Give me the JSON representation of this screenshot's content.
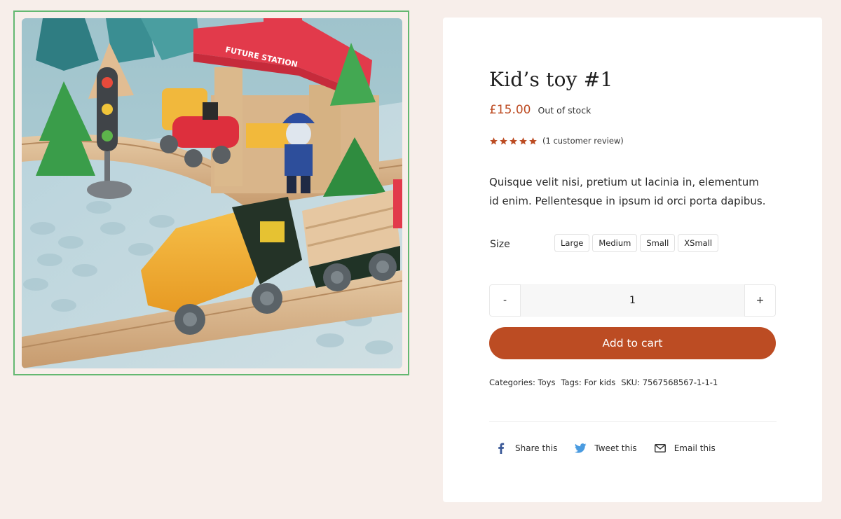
{
  "product": {
    "title": "Kid’s toy #1",
    "price": "£15.00",
    "stock_status": "Out of stock",
    "rating": {
      "stars": 5,
      "review_text": "(1 customer review)"
    },
    "description": "Quisque velit nisi, pretium ut lacinia in, elementum id enim. Pellentesque in ipsum id orci porta dapibus.",
    "size": {
      "label": "Size",
      "options": [
        "Large",
        "Medium",
        "Small",
        "XSmall"
      ]
    },
    "quantity": {
      "value": "1",
      "minus_label": "-",
      "plus_label": "+"
    },
    "add_to_cart_label": "Add to cart",
    "meta": {
      "categories_label": "Categories:",
      "categories": "Toys",
      "tags_label": "Tags:",
      "tags": "For kids",
      "sku_label": "SKU:",
      "sku": "7567568567-1-1-1"
    },
    "share": [
      {
        "label": "Share this",
        "icon": "facebook-icon",
        "color": "#3b5998"
      },
      {
        "label": "Tweet this",
        "icon": "twitter-icon",
        "color": "#4a9be0"
      },
      {
        "label": "Email this",
        "icon": "email-icon",
        "color": "#333333"
      }
    ],
    "image": {
      "station_sign": "FUTURE STATION"
    }
  },
  "colors": {
    "accent": "#bc4c23",
    "price": "#bd4b22",
    "gallery_border": "#64b871",
    "page_background": "#f7eeea"
  }
}
